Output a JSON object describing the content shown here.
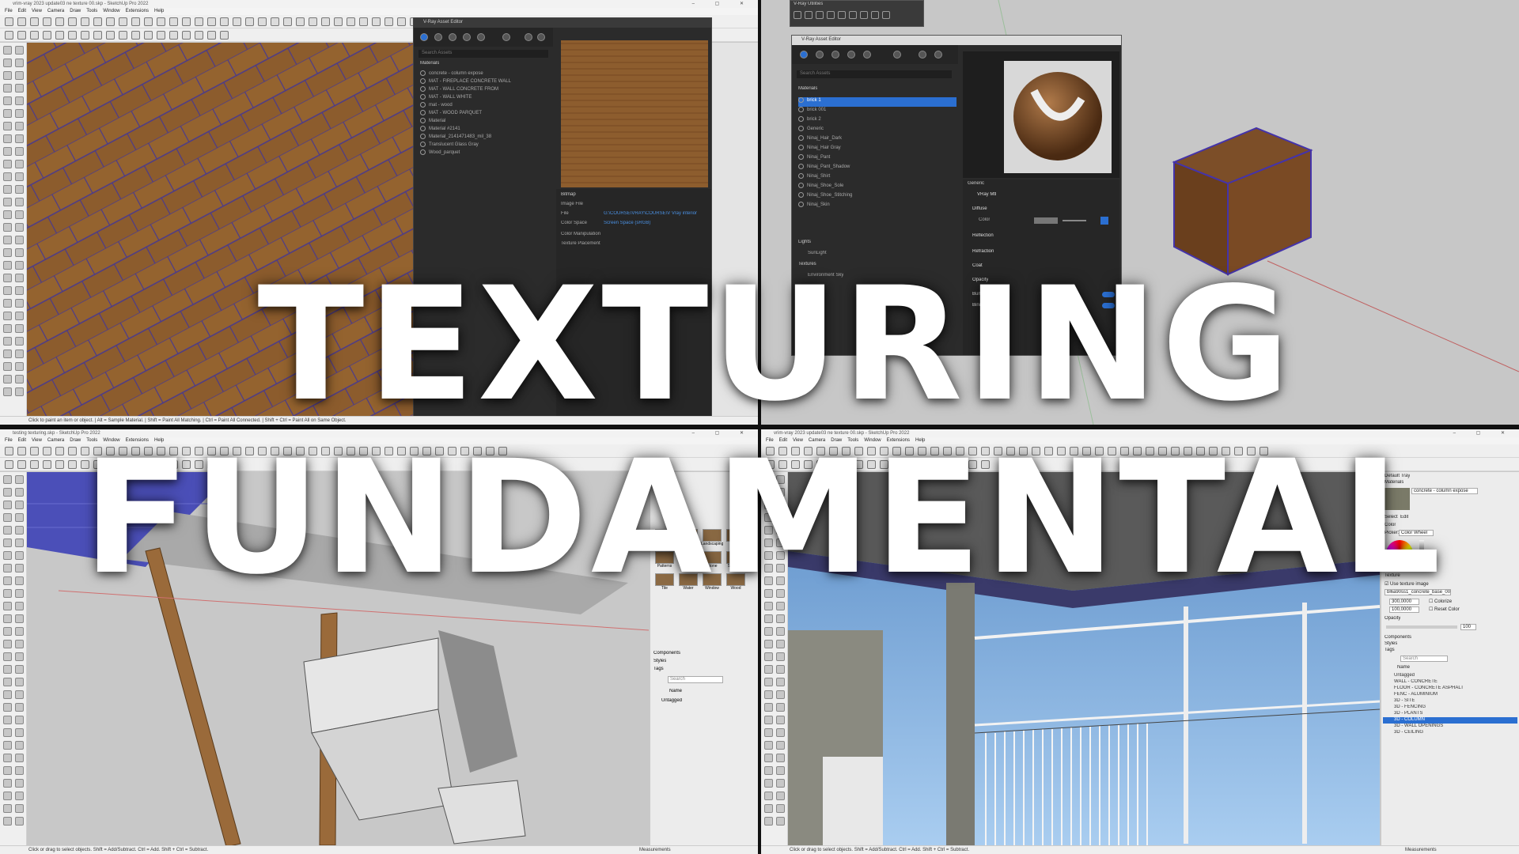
{
  "overlay": {
    "line1": "TEXTURING",
    "line2": "FUNDAMENTAL"
  },
  "q1": {
    "window_title": "vrim-vray 2023 update03 ne texture 00.skp - SketchUp Pro 2022",
    "menu": [
      "File",
      "Edit",
      "View",
      "Camera",
      "Draw",
      "Tools",
      "Window",
      "Extensions",
      "Help"
    ],
    "asset_editor_title": "V-Ray Asset Editor",
    "search_placeholder": "Search Assets",
    "materials_header": "Materials",
    "materials": [
      "concrete - column expose",
      "MAT - FIREPLACE CONCRETE WALL",
      "MAT - WALL CONCRETE FROM",
      "MAT - WALL WHITE",
      "mat - wood",
      "MAT - WOOD PARQUET",
      "Material",
      "Material #2141",
      "Material_2141471483_mil_38",
      "Translucent Glass Gray",
      "Wood_parquet"
    ],
    "bitmap_header": "Bitmap",
    "image_file_label": "Image File",
    "file_label": "File",
    "file_value": "G:\\COURSE\\VRAY\\COURSE\\V Vray interior ren...",
    "color_space_label": "Color Space",
    "color_space_value": "Screen Space (sRGB)",
    "color_manipulation": "Color Manipulation",
    "texture_placement": "Texture Placement",
    "status_text": "Click to paint an item or object. | Alt = Sample Material. | Shift = Paint All Matching. | Ctrl = Paint All Connected. | Shift + Ctrl = Paint All on Same Object."
  },
  "q2": {
    "utilities_title": "V-Ray Utilities",
    "asset_editor_title": "V-Ray Asset Editor",
    "search_placeholder": "Search Assets",
    "materials_header": "Materials",
    "materials": [
      "brick 1",
      "brick 001",
      "brick 2",
      "Generic",
      "Ninaj_Hair_Dark",
      "Ninaj_Hair Gray",
      "Ninaj_Pant",
      "Ninaj_Pant_Shadow",
      "Ninaj_Shirt",
      "Ninaj_Shoe_Sole",
      "Ninaj_Shoe_Stitching",
      "Ninaj_Skin"
    ],
    "lights_header": "Lights",
    "lights": [
      "SunLight"
    ],
    "textures_header": "Textures",
    "textures": [
      "Environment Sky"
    ],
    "generic_header": "Generic",
    "layer_name": "VRay Mtl",
    "sections": [
      "Diffuse",
      "Reflection",
      "Refraction",
      "Coat",
      "Opacity"
    ],
    "color_label": "Color",
    "bump_label": "Bump",
    "binding_label": "Binding"
  },
  "q3": {
    "window_title": "testing texturing.skp - SketchUp Pro 2022",
    "menu": [
      "File",
      "Edit",
      "View",
      "Camera",
      "Draw",
      "Tools",
      "Window",
      "Extensions",
      "Help"
    ],
    "material_categories": [
      "Colors",
      "Colors-Named",
      "Landscaping",
      "Metal",
      "Patterns",
      "Roofing",
      "Stone",
      "Synthetic",
      "Tile",
      "Water",
      "Window",
      "Wood"
    ],
    "tray_sections": [
      "Components",
      "Styles",
      "Tags"
    ],
    "search_placeholder": "Search",
    "name_col": "Name",
    "tag_row": "Untagged",
    "status_text": "Click or drag to select objects. Shift = Add/Subtract. Ctrl = Add. Shift + Ctrl = Subtract.",
    "measurements_label": "Measurements"
  },
  "q4": {
    "window_title": "vrim-vray 2023 update03 ne texture 00.skp - SketchUp Pro 2022",
    "menu": [
      "File",
      "Edit",
      "View",
      "Camera",
      "Draw",
      "Tools",
      "Window",
      "Extensions",
      "Help"
    ],
    "tray_title": "Default Tray",
    "materials_label": "Materials",
    "material_name": "concrete - column expose",
    "select_tab": "Select",
    "edit_tab": "Edit",
    "color_label": "Color",
    "picker_label": "Picker:",
    "picker_value": "Color Wheel",
    "texture_label": "Texture",
    "use_texture_label": "Use texture image",
    "texture_file": "bl6a90ss1_concrete_base_003",
    "width_value": "300,0000",
    "height_value": "100,0000",
    "colorize_label": "Colorize",
    "reset_color_label": "Reset Color",
    "opacity_label": "Opacity",
    "opacity_value": "100",
    "tray_sections": [
      "Components",
      "Styles",
      "Tags"
    ],
    "search_placeholder": "Search",
    "name_col": "Name",
    "tags": [
      "Untagged",
      "WALL - CONCRETE",
      "FLOOR - CONCRETE ASPHALT",
      "FENC - ALUMINIUM",
      "3D - SITE",
      "3D - FENCING",
      "3D - PLANTS",
      "3D - COLUMN",
      "3D - WALL OPENINGS",
      "3D - CEILING"
    ],
    "selected_tag_index": 7,
    "status_text": "Click or drag to select objects. Shift = Add/Subtract. Ctrl = Add. Shift + Ctrl = Subtract.",
    "measurements_label": "Measurements"
  },
  "colors": {
    "wood": "#8a5a2b",
    "dark_panel": "#2b2b2b",
    "accent_blue": "#2b6fd1",
    "sky": "#8ab8e6",
    "brick_blue": "#4b4fb8"
  }
}
